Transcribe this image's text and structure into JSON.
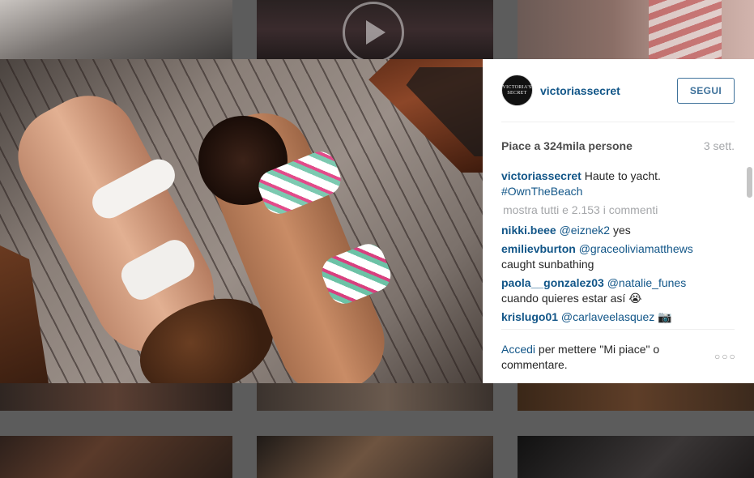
{
  "post": {
    "username": "victoriassecret",
    "avatar_text": "VICTORIA'S SECRET",
    "follow_label": "SEGUI",
    "likes_text": "Piace a 324mila persone",
    "time_text": "3 sett.",
    "caption_user": "victoriassecret",
    "caption_text": "Haute to yacht.",
    "caption_hashtag": "#OwnTheBeach",
    "show_all_comments": "mostra tutti e 2.153 i commenti",
    "comments": [
      {
        "user": "nikki.beee",
        "mention": "@eiznek2",
        "text": "yes"
      },
      {
        "user": "emilievburton",
        "mention": "@graceoliviamatthews",
        "text": "caught sunbathing"
      },
      {
        "user": "paola__gonzalez03",
        "mention": "@natalie_funes",
        "text": "cuando quieres estar así 😭"
      },
      {
        "user": "krislugo01",
        "mention": "@carlaveelasquez",
        "text": "📷"
      }
    ],
    "login_link": "Accedi",
    "login_text": " per mettere \"Mi piace\" o commentare.",
    "more_icon_glyph": "○○○"
  },
  "icons": {
    "play": "play-icon",
    "more": "more-options-icon"
  },
  "colors": {
    "link": "#125688",
    "follow_border": "#3f729b",
    "muted": "#a5a7aa"
  }
}
